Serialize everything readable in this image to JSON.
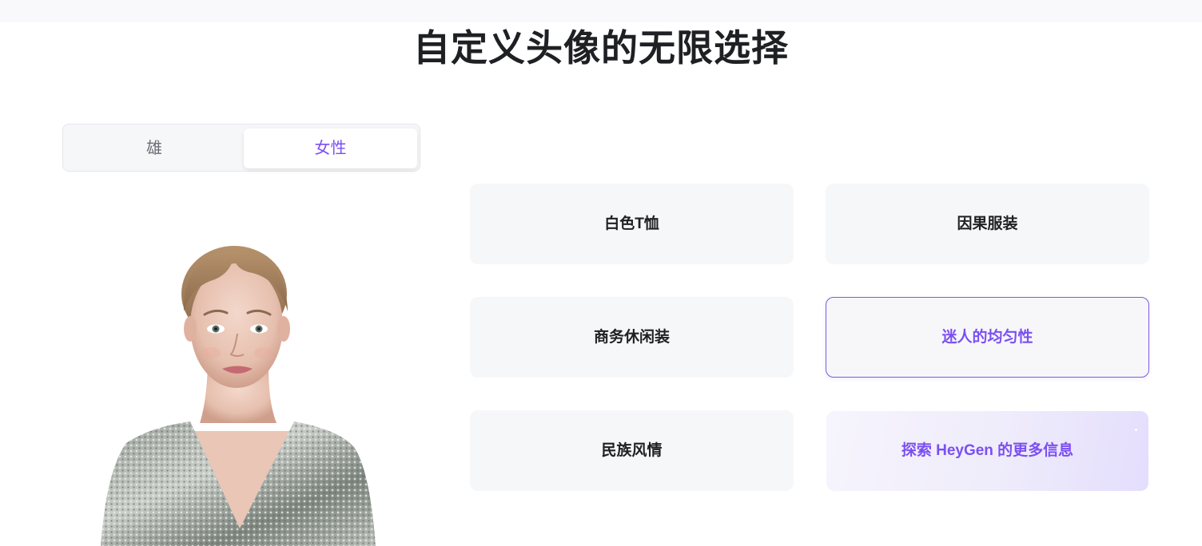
{
  "page": {
    "title": "自定义头像的无限选择"
  },
  "gender_toggle": {
    "options": [
      {
        "label": "雄",
        "selected": false
      },
      {
        "label": "女性",
        "selected": true
      }
    ],
    "accent_color": "#7b4ff2"
  },
  "avatar": {
    "description_icon": "avatar-woman-sequin-dress"
  },
  "styles": [
    {
      "label": "白色T恤",
      "selected": false
    },
    {
      "label": "因果服装",
      "selected": false
    },
    {
      "label": "商务休闲装",
      "selected": false
    },
    {
      "label": "迷人的均匀性",
      "selected": true
    },
    {
      "label": "民族风情",
      "selected": false
    }
  ],
  "explore": {
    "label": "探索 HeyGen 的更多信息"
  },
  "colors": {
    "accent": "#7b4ff2",
    "card_bg": "#f6f7f9",
    "text_dark": "#1f2024"
  }
}
